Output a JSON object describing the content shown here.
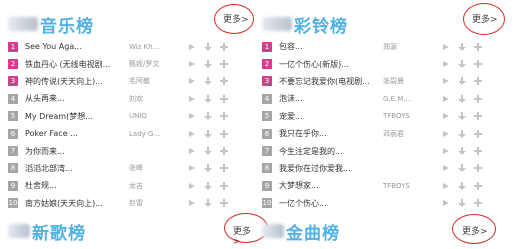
{
  "panels": [
    {
      "title": "音乐榜",
      "more_label": "更多>",
      "rows": [
        {
          "rank": "1",
          "title": "See You Aga...",
          "artist": "Wiz Kh...",
          "hot": true
        },
        {
          "rank": "2",
          "title": "铁血丹心 (无线电视剧...",
          "artist": "甄妮/罗文",
          "hot": true
        },
        {
          "rank": "3",
          "title": "神的传说(天天向上)...",
          "artist": "毛阿敏",
          "hot": true
        },
        {
          "rank": "4",
          "title": "从头再来...",
          "artist": "刘欢",
          "hot": false
        },
        {
          "rank": "5",
          "title": "My Dream(梦想...",
          "artist": "UNIQ",
          "hot": false
        },
        {
          "rank": "6",
          "title": "Poker Face ...",
          "artist": "Lady G...",
          "hot": false
        },
        {
          "rank": "7",
          "title": "为你而来...",
          "artist": "",
          "hot": false
        },
        {
          "rank": "8",
          "title": "滔滔北部湾...",
          "artist": "张峰",
          "hot": false
        },
        {
          "rank": "9",
          "title": "杜舍规...",
          "artist": "龙吉",
          "hot": false
        },
        {
          "rank": "10",
          "title": "南方姑娘(天天向上)...",
          "artist": "赵雷",
          "hot": false
        }
      ]
    },
    {
      "title": "彩铃榜",
      "more_label": "更多>",
      "rows": [
        {
          "rank": "1",
          "title": "包容...",
          "artist": "郑源",
          "hot": true
        },
        {
          "rank": "2",
          "title": "一亿个伤心(新版)...",
          "artist": "",
          "hot": true
        },
        {
          "rank": "3",
          "title": "不要忘记我爱你(电视剧...",
          "artist": "张碧晨",
          "hot": true
        },
        {
          "rank": "4",
          "title": "泡沫...",
          "artist": "G.E.M....",
          "hot": false
        },
        {
          "rank": "5",
          "title": "宠爱...",
          "artist": "TFBOYS",
          "hot": false
        },
        {
          "rank": "6",
          "title": "我只在乎你...",
          "artist": "邓丽君",
          "hot": false
        },
        {
          "rank": "7",
          "title": "今生注定是我的...",
          "artist": "",
          "hot": false
        },
        {
          "rank": "8",
          "title": "我爱你在过你爱我...",
          "artist": "",
          "hot": false
        },
        {
          "rank": "9",
          "title": "大梦想家...",
          "artist": "TFBOYS",
          "hot": false
        },
        {
          "rank": "10",
          "title": "一亿个伤心...",
          "artist": "",
          "hot": false
        }
      ]
    }
  ],
  "bottom_sections": [
    {
      "title": "新歌榜",
      "more_label": "更多>"
    },
    {
      "title": "金曲榜",
      "more_label": "更多>"
    }
  ],
  "colors": {
    "title_blue": "#4fb2e3",
    "rank_hot": "#d2408d",
    "rank_normal": "#a6a6a6",
    "annotation_red": "#d62c2c"
  },
  "icons": [
    "play-icon",
    "download-icon",
    "add-icon"
  ]
}
